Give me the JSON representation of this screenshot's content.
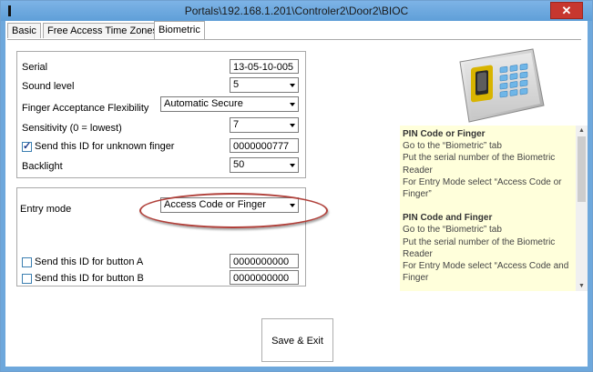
{
  "window": {
    "title": "Portals\\192.168.1.201\\Controler2\\Door2\\BIOC",
    "close_label": "✕"
  },
  "tabs": [
    {
      "label": "Basic"
    },
    {
      "label": "Free Access Time Zones"
    },
    {
      "label": "Biometric",
      "active": true
    }
  ],
  "settings": {
    "serial": {
      "label": "Serial",
      "value": "13-05-10-005"
    },
    "sound_level": {
      "label": "Sound level",
      "value": "5"
    },
    "finger_flex": {
      "label": "Finger Acceptance Flexibility",
      "value": "Automatic Secure"
    },
    "sensitivity": {
      "label": "Sensitivity (0 = lowest)",
      "value": "7"
    },
    "unknown_finger": {
      "label": "Send this ID for unknown finger",
      "checked": true,
      "value": "0000000777"
    },
    "backlight": {
      "label": "Backlight",
      "value": "50"
    }
  },
  "entry": {
    "label": "Entry mode",
    "value": "Access Code or Finger",
    "button_a": {
      "label": "Send this ID for button A",
      "checked": false,
      "value": "0000000000"
    },
    "button_b": {
      "label": "Send this ID for button B",
      "checked": false,
      "value": "0000000000"
    }
  },
  "info": {
    "section1_title": "PIN Code or Finger",
    "section1_lines": [
      "Go to the “Biometric” tab",
      "Put the serial number of the Biometric Reader",
      "For Entry Mode select “Access Code or Finger”"
    ],
    "section2_title": "PIN Code and Finger",
    "section2_lines": [
      "Go to the “Biometric” tab",
      "Put the serial number of the Biometric Reader",
      "For Entry Mode select “Access Code and Finger"
    ]
  },
  "save_button": "Save & Exit",
  "colors": {
    "title_bar": "#6ea8dc",
    "close": "#c7372f",
    "highlight": "#b0403a",
    "info_bg": "#ffffdb"
  }
}
